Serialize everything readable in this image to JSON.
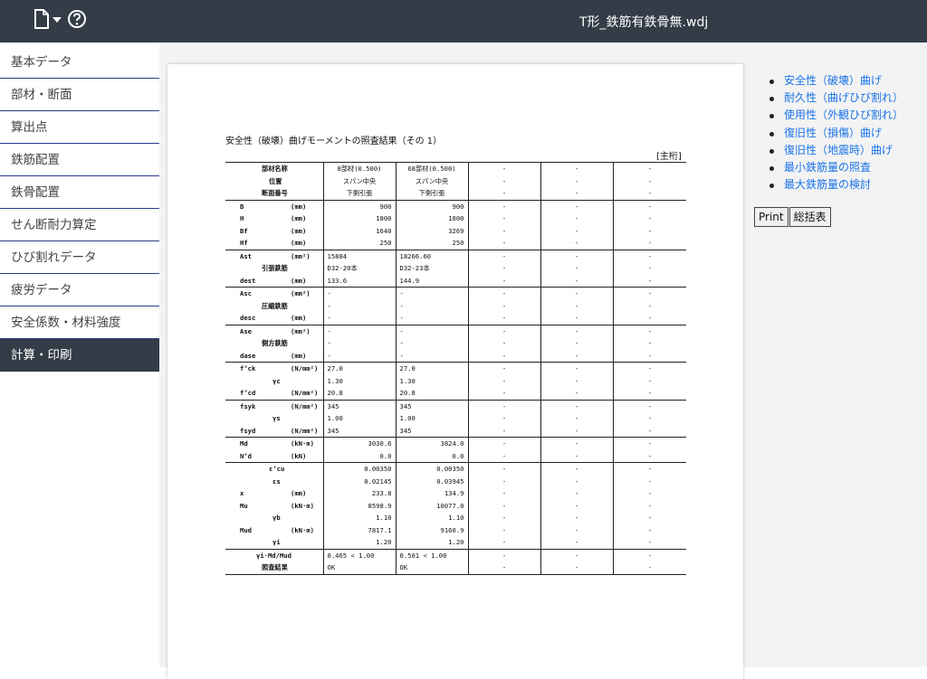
{
  "header": {
    "title": "T形_鉄筋有鉄骨無.wdj",
    "icons": [
      "file-icon",
      "caret-down-icon",
      "help-icon"
    ]
  },
  "sidebar": {
    "items": [
      {
        "label": "基本データ"
      },
      {
        "label": "部材・断面"
      },
      {
        "label": "算出点"
      },
      {
        "label": "鉄筋配置"
      },
      {
        "label": "鉄骨配置"
      },
      {
        "label": "せん断耐力算定"
      },
      {
        "label": "ひび割れデータ"
      },
      {
        "label": "疲労データ"
      },
      {
        "label": "安全係数・材料強度"
      },
      {
        "label": "計算・印刷",
        "active": true
      }
    ]
  },
  "report": {
    "title": "安全性（破壊）曲げモーメントの照査結果（その 1）",
    "note": "[主桁]",
    "rows": [
      {
        "sym": "部材名称",
        "unit": "",
        "a": "8部材(0.500)",
        "b": "68部材(0.500)",
        "align": "c",
        "group": true
      },
      {
        "sym": "位置",
        "unit": "",
        "a": "スパン中央",
        "b": "スパン中央",
        "align": "c"
      },
      {
        "sym": "断面番号",
        "unit": "",
        "a": "下側引張",
        "b": "下側引張",
        "align": "c"
      },
      {
        "sym": "B",
        "unit": "(mm)",
        "a": "900",
        "b": "900",
        "align": "r",
        "group": true
      },
      {
        "sym": "H",
        "unit": "(mm)",
        "a": "1800",
        "b": "1800",
        "align": "r"
      },
      {
        "sym": "Bf",
        "unit": "(mm)",
        "a": "1640",
        "b": "3269",
        "align": "r"
      },
      {
        "sym": "Hf",
        "unit": "(mm)",
        "a": "250",
        "b": "250",
        "align": "r"
      },
      {
        "sym": "Ast",
        "unit": "(mm²)",
        "a": "15884",
        "b": "18266.60",
        "align": "l",
        "group": true
      },
      {
        "sym": "引張鉄筋",
        "unit": "",
        "a": "D32-20本",
        "b": "D32-23本",
        "align": "l"
      },
      {
        "sym": "dest",
        "unit": "(mm)",
        "a": "133.6",
        "b": "144.9",
        "align": "l"
      },
      {
        "sym": "Asc",
        "unit": "(mm²)",
        "a": "-",
        "b": "-",
        "align": "l",
        "group": true
      },
      {
        "sym": "圧縮鉄筋",
        "unit": "",
        "a": "-",
        "b": "-",
        "align": "l"
      },
      {
        "sym": "desc",
        "unit": "(mm)",
        "a": "-",
        "b": "-",
        "align": "l"
      },
      {
        "sym": "Ase",
        "unit": "(mm²)",
        "a": "-",
        "b": "-",
        "align": "l",
        "group": true
      },
      {
        "sym": "側方鉄筋",
        "unit": "",
        "a": "-",
        "b": "-",
        "align": "l"
      },
      {
        "sym": "dase",
        "unit": "(mm)",
        "a": "-",
        "b": "-",
        "align": "l"
      },
      {
        "sym": "f’ck",
        "unit": "(N/mm²)",
        "a": "27.0",
        "b": "27.0",
        "align": "l",
        "group": true
      },
      {
        "sym": "γc",
        "unit": "",
        "a": "1.30",
        "b": "1.30",
        "align": "l"
      },
      {
        "sym": "f’cd",
        "unit": "(N/mm²)",
        "a": "20.8",
        "b": "20.8",
        "align": "l"
      },
      {
        "sym": "fsyk",
        "unit": "(N/mm²)",
        "a": "345",
        "b": "345",
        "align": "l",
        "group": true
      },
      {
        "sym": "γs",
        "unit": "",
        "a": "1.00",
        "b": "1.00",
        "align": "l"
      },
      {
        "sym": "fsyd",
        "unit": "(N/mm²)",
        "a": "345",
        "b": "345",
        "align": "l"
      },
      {
        "sym": "Md",
        "unit": "(kN·m)",
        "a": "3030.6",
        "b": "3824.0",
        "align": "r",
        "group": true
      },
      {
        "sym": "N’d",
        "unit": "(kN)",
        "a": "0.0",
        "b": "0.0",
        "align": "r"
      },
      {
        "sym": "ε’cu",
        "unit": "",
        "a": "0.00350",
        "b": "0.00350",
        "align": "r",
        "group": true
      },
      {
        "sym": "εs",
        "unit": "",
        "a": "0.02145",
        "b": "0.03945",
        "align": "r"
      },
      {
        "sym": "x",
        "unit": "(mm)",
        "a": "233.8",
        "b": "134.9",
        "align": "r"
      },
      {
        "sym": "Mu",
        "unit": "(kN·m)",
        "a": "8598.9",
        "b": "10077.0",
        "align": "r"
      },
      {
        "sym": "γb",
        "unit": "",
        "a": "1.10",
        "b": "1.10",
        "align": "r"
      },
      {
        "sym": "Mud",
        "unit": "(kN·m)",
        "a": "7817.1",
        "b": "9160.9",
        "align": "r"
      },
      {
        "sym": "γi",
        "unit": "",
        "a": "1.20",
        "b": "1.20",
        "align": "r"
      },
      {
        "sym": "γi·Md/Mud",
        "unit": "",
        "a": "0.465 < 1.00",
        "b": "0.501 < 1.00",
        "align": "l",
        "group": true
      },
      {
        "sym": "照査結果",
        "unit": "",
        "a": "OK",
        "b": "OK",
        "align": "l"
      }
    ],
    "empty_cell": "-"
  },
  "links": [
    "安全性（破壊）曲げ",
    "耐久性（曲げひび割れ）",
    "使用性（外観ひび割れ）",
    "復旧性（損傷）曲げ",
    "復旧性（地震時）曲げ",
    "最小鉄筋量の照査",
    "最大鉄筋量の検討"
  ],
  "buttons": {
    "print": "Print",
    "summary": "総括表"
  },
  "colors": {
    "header_bg": "#333c47",
    "sidebar_border": "#2c3a8c",
    "link": "#1a73e8",
    "content_bg": "#f3f3f4"
  }
}
